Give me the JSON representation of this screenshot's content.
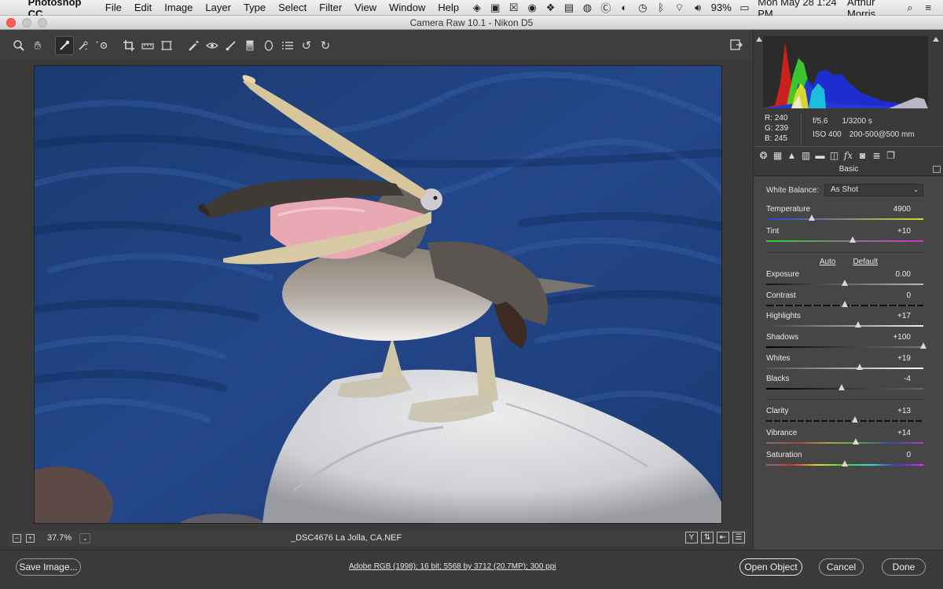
{
  "menubar": {
    "app_name": "Photoshop CC",
    "items": [
      "File",
      "Edit",
      "Image",
      "Layer",
      "Type",
      "Select",
      "Filter",
      "View",
      "Window",
      "Help"
    ],
    "battery": "93%",
    "datetime": "Mon May 28  1:24 PM",
    "user": "Arthur Morris"
  },
  "window": {
    "title": "Camera Raw 10.1  -  Nikon D5"
  },
  "statusbar": {
    "zoom": "37.7%",
    "filename": "_DSC4676  La  Jolla, CA.NEF",
    "view_y": "Y"
  },
  "readout": {
    "r": "R:  240",
    "g": "G:  239",
    "b": "B:  245",
    "aperture": "f/5.6",
    "shutter": "1/3200 s",
    "iso": "ISO 400",
    "lens": "200-500@500 mm"
  },
  "panel": {
    "title": "Basic",
    "white_balance_label": "White Balance:",
    "white_balance_value": "As Shot",
    "auto": "Auto",
    "default": "Default"
  },
  "sliders": {
    "temperature": {
      "label": "Temperature",
      "value": "4900",
      "level": 0.29
    },
    "tint": {
      "label": "Tint",
      "value": "+10",
      "level": 0.55
    },
    "exposure": {
      "label": "Exposure",
      "value": "0.00",
      "level": 0.5
    },
    "contrast": {
      "label": "Contrast",
      "value": "0",
      "level": 0.5
    },
    "highlights": {
      "label": "Highlights",
      "value": "+17",
      "level": 0.585
    },
    "shadows": {
      "label": "Shadows",
      "value": "+100",
      "level": 1.0
    },
    "whites": {
      "label": "Whites",
      "value": "+19",
      "level": 0.595
    },
    "blacks": {
      "label": "Blacks",
      "value": "-4",
      "level": 0.48
    },
    "clarity": {
      "label": "Clarity",
      "value": "+13",
      "level": 0.565
    },
    "vibrance": {
      "label": "Vibrance",
      "value": "+14",
      "level": 0.57
    },
    "saturation": {
      "label": "Saturation",
      "value": "0",
      "level": 0.5
    }
  },
  "bottom": {
    "save_image": "Save Image...",
    "workflow": "Adobe RGB (1998); 16 bit; 5568 by 3712 (20.7MP); 300 ppi",
    "open_object": "Open Object",
    "cancel": "Cancel",
    "done": "Done"
  },
  "colors": {
    "close": "#ff5f57",
    "panel_bg": "#464646",
    "ocean": "#1d3f78"
  }
}
